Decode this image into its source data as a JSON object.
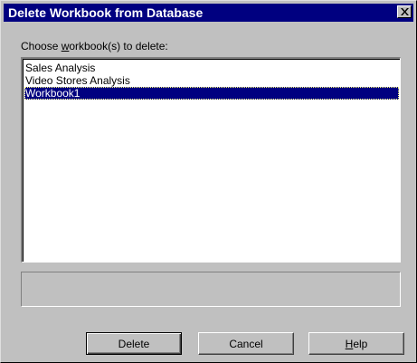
{
  "window": {
    "title": "Delete Workbook from Database"
  },
  "prompt": {
    "before": "Choose ",
    "accel": "w",
    "after": "orkbook(s) to delete:"
  },
  "workbooks": [
    {
      "label": "Sales Analysis",
      "selected": false
    },
    {
      "label": "Video Stores Analysis",
      "selected": false
    },
    {
      "label": "Workbook1",
      "selected": true
    }
  ],
  "status_text": "",
  "buttons": {
    "delete_label": "Delete",
    "cancel_label": "Cancel",
    "help_accel": "H",
    "help_rest": "elp"
  },
  "colors": {
    "title_bar": "#000080",
    "face": "#c0c0c0",
    "selection": "#000080"
  }
}
